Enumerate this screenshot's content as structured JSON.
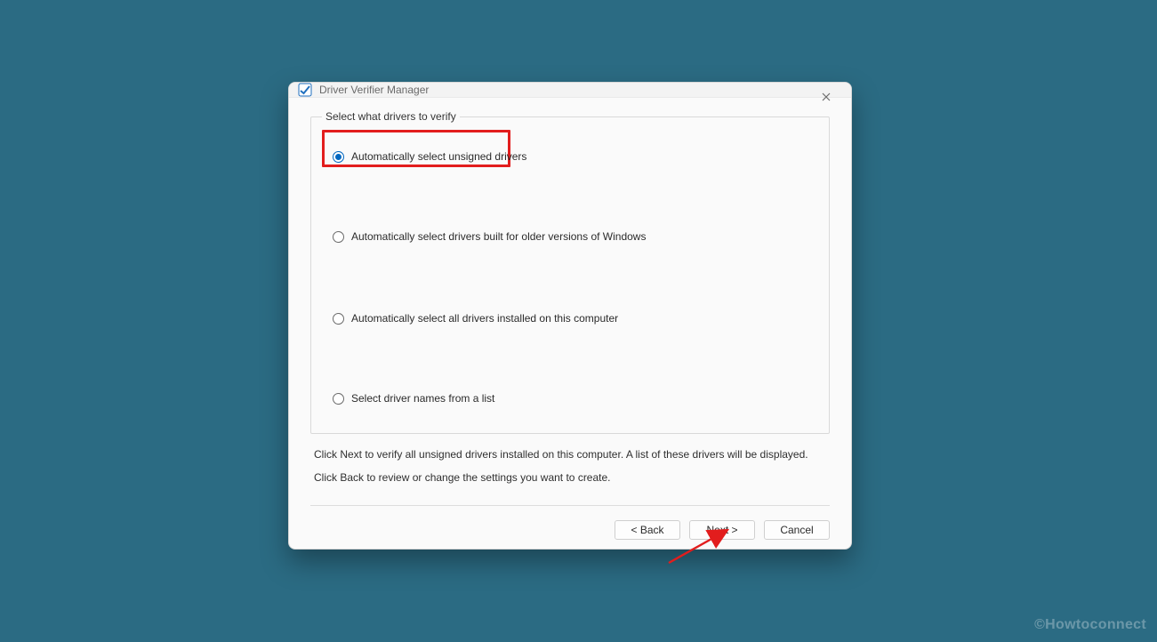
{
  "window": {
    "title": "Driver Verifier Manager"
  },
  "group": {
    "legend": "Select what drivers to verify",
    "options": [
      {
        "label": "Automatically select unsigned drivers",
        "checked": true
      },
      {
        "label": "Automatically select drivers built for older versions of Windows",
        "checked": false
      },
      {
        "label": "Automatically select all drivers installed on this computer",
        "checked": false
      },
      {
        "label": "Select driver names from a list",
        "checked": false
      }
    ]
  },
  "info": {
    "line1": "Click Next to verify all unsigned drivers installed on this computer. A list of these drivers will be displayed.",
    "line2": "Click Back to review or change the settings you want to create."
  },
  "buttons": {
    "back": "< Back",
    "next": "Next >",
    "cancel": "Cancel"
  },
  "watermark": "©Howtoconnect"
}
